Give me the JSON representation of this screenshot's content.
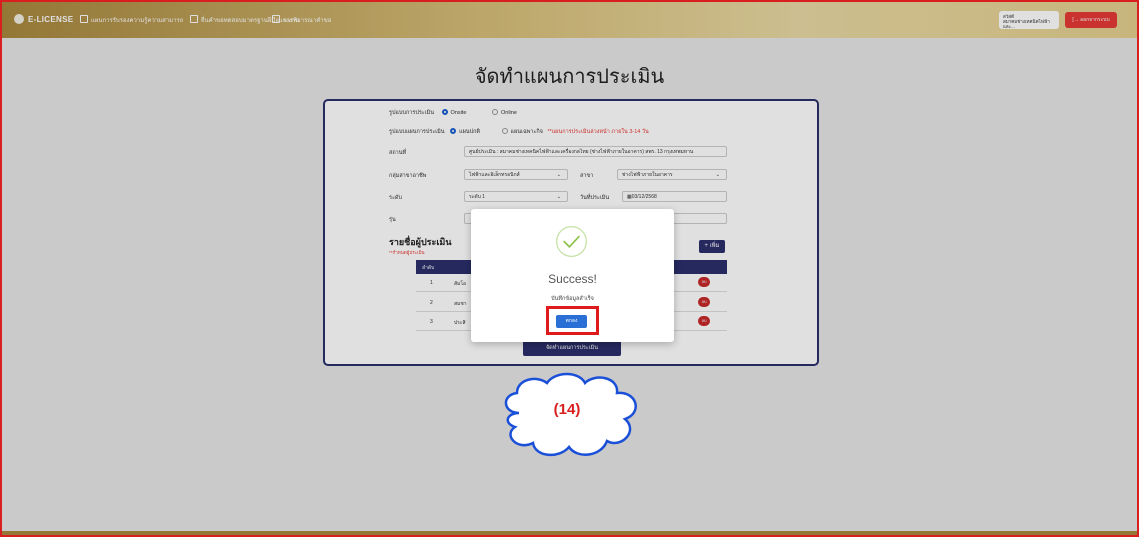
{
  "nav": {
    "brand": "E-LICENSE",
    "items": [
      "แผนการรับรองความรู้ความสามารถ",
      "ยื่นคำขอทดสอบมาตรฐานฝีมือแรงงาน",
      "การพิจารณาคำขอ"
    ],
    "user_line1": "สวัสดี",
    "user_line2": "สมาคมช่างเทคนิคไฟฟ้าและ...",
    "logout": "ออกจากระบบ"
  },
  "page": {
    "title": "จัดทำแผนการประเมิน"
  },
  "form": {
    "format_label": "รูปแบบการประเมิน",
    "format_options": [
      "Onsite",
      "Online"
    ],
    "plan_label": "รูปแบบแผนการประเมิน",
    "plan_options": [
      "แผนปกติ",
      "แผนเฉพาะกิจ"
    ],
    "plan_note": "**แผนการประเมินล่วงหน้า ภายใน 3-14 วัน",
    "location_label": "สถานที่",
    "location_value": "ศูนย์ประเมิน : สมาคมช่างเทคนิคไฟฟ้าและเครื่องกลไทย (ช่างไฟฟ้าภายในอาคาร) สพร. 13 กรุงเทพมหาน",
    "group_label": "กลุ่มสาขาอาชีพ",
    "group_value": "ไฟฟ้าและอิเล็กทรอนิกส์",
    "branch_label": "สาขา",
    "branch_value": "ช่างไฟฟ้าภายในอาคาร",
    "level_label": "ระดับ",
    "level_value": "ระดับ 1",
    "date_label": "วันที่ประเมิน",
    "date_value": "03/12/2568",
    "batch_label": "รุ่น",
    "assessors_title": "รายชื่อผู้ประเมิน",
    "assessors_note": "**กำหนดผู้ประเมิน",
    "add_button": "+ เพิ่ม",
    "table_header": "ลำดับ",
    "rows": [
      {
        "no": "1",
        "name": "สัมโอ",
        "action": "ลบ"
      },
      {
        "no": "2",
        "name": "สมชา",
        "action": "ลบ"
      },
      {
        "no": "3",
        "name": "ประสิ",
        "action": "ลบ"
      }
    ],
    "submit_button": "จัดทำแผนการประเมิน"
  },
  "modal": {
    "title": "Success!",
    "message": "บันทึกข้อมูลสำเร็จ",
    "ok_button": "ตกลง"
  },
  "annotation": {
    "label": "(14)"
  },
  "colors": {
    "accent": "#2b2f6b",
    "success": "#8bc34a",
    "highlight": "#e01a1a"
  }
}
